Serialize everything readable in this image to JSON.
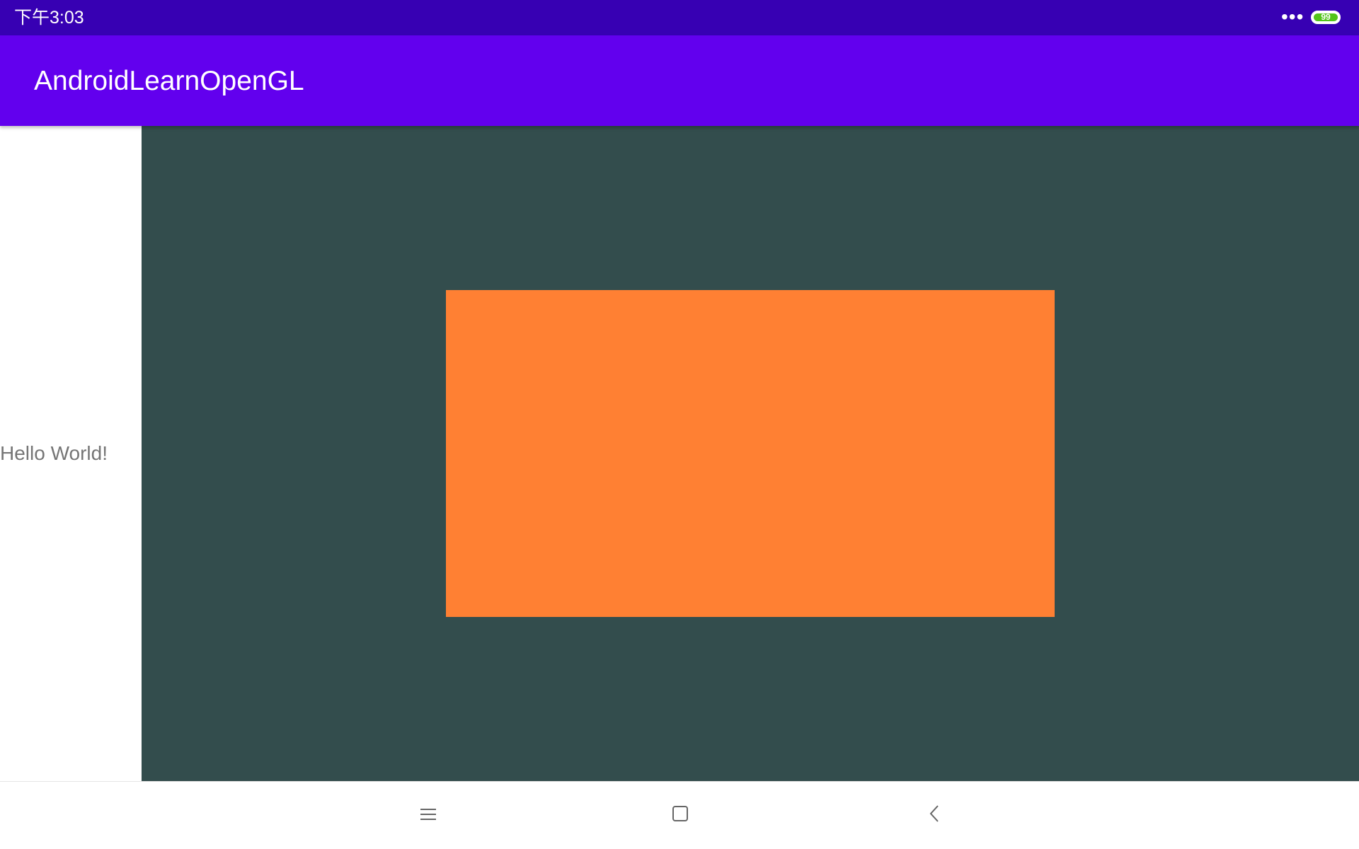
{
  "status_bar": {
    "time": "下午3:03",
    "more_indicator": "•••",
    "battery_level": "99",
    "battery_color": "#52c41a"
  },
  "app_bar": {
    "title": "AndroidLearnOpenGL",
    "color": "#6200ee"
  },
  "content": {
    "hello_text": "Hello World!",
    "gl_clear_color": "#334d4d",
    "gl_shape_color": "#ff8033"
  },
  "nav_bar": {
    "recent_icon": "menu-icon",
    "home_icon": "square-icon",
    "back_icon": "chevron-left-icon"
  }
}
